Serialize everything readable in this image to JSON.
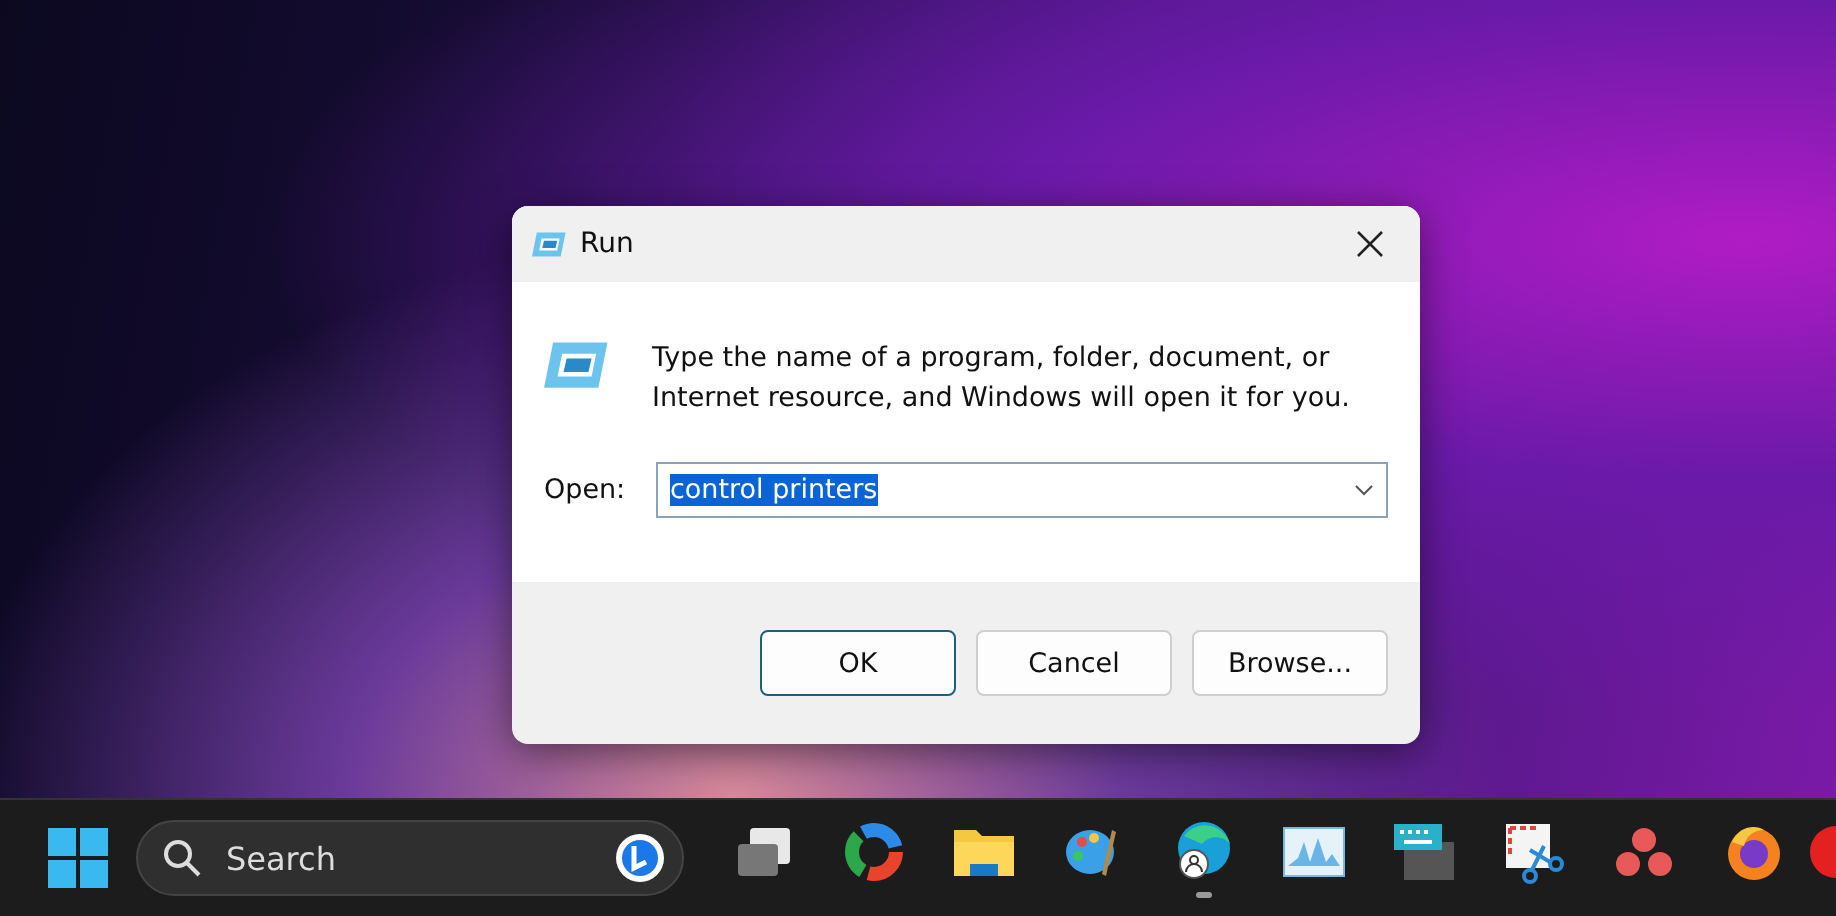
{
  "dialog": {
    "title": "Run",
    "message": "Type the name of a program, folder, document, or Internet resource, and Windows will open it for you.",
    "open_label": "Open:",
    "open_value": "control printers",
    "value_selected": true,
    "buttons": [
      {
        "label": "OK",
        "default": true
      },
      {
        "label": "Cancel",
        "default": false
      },
      {
        "label": "Browse...",
        "default": false
      }
    ]
  },
  "taskbar": {
    "search": {
      "placeholder": "Search"
    },
    "apps": [
      {
        "kind": "taskview",
        "running": false
      },
      {
        "kind": "ring",
        "running": false
      },
      {
        "kind": "folder",
        "running": false
      },
      {
        "kind": "palette",
        "running": false
      },
      {
        "kind": "browser",
        "running": true
      },
      {
        "kind": "monitor",
        "running": false
      },
      {
        "kind": "keyboard",
        "running": false
      },
      {
        "kind": "snip",
        "running": false
      },
      {
        "kind": "dots",
        "running": false
      },
      {
        "kind": "fox",
        "running": false
      },
      {
        "kind": "partial",
        "running": false
      }
    ]
  }
}
